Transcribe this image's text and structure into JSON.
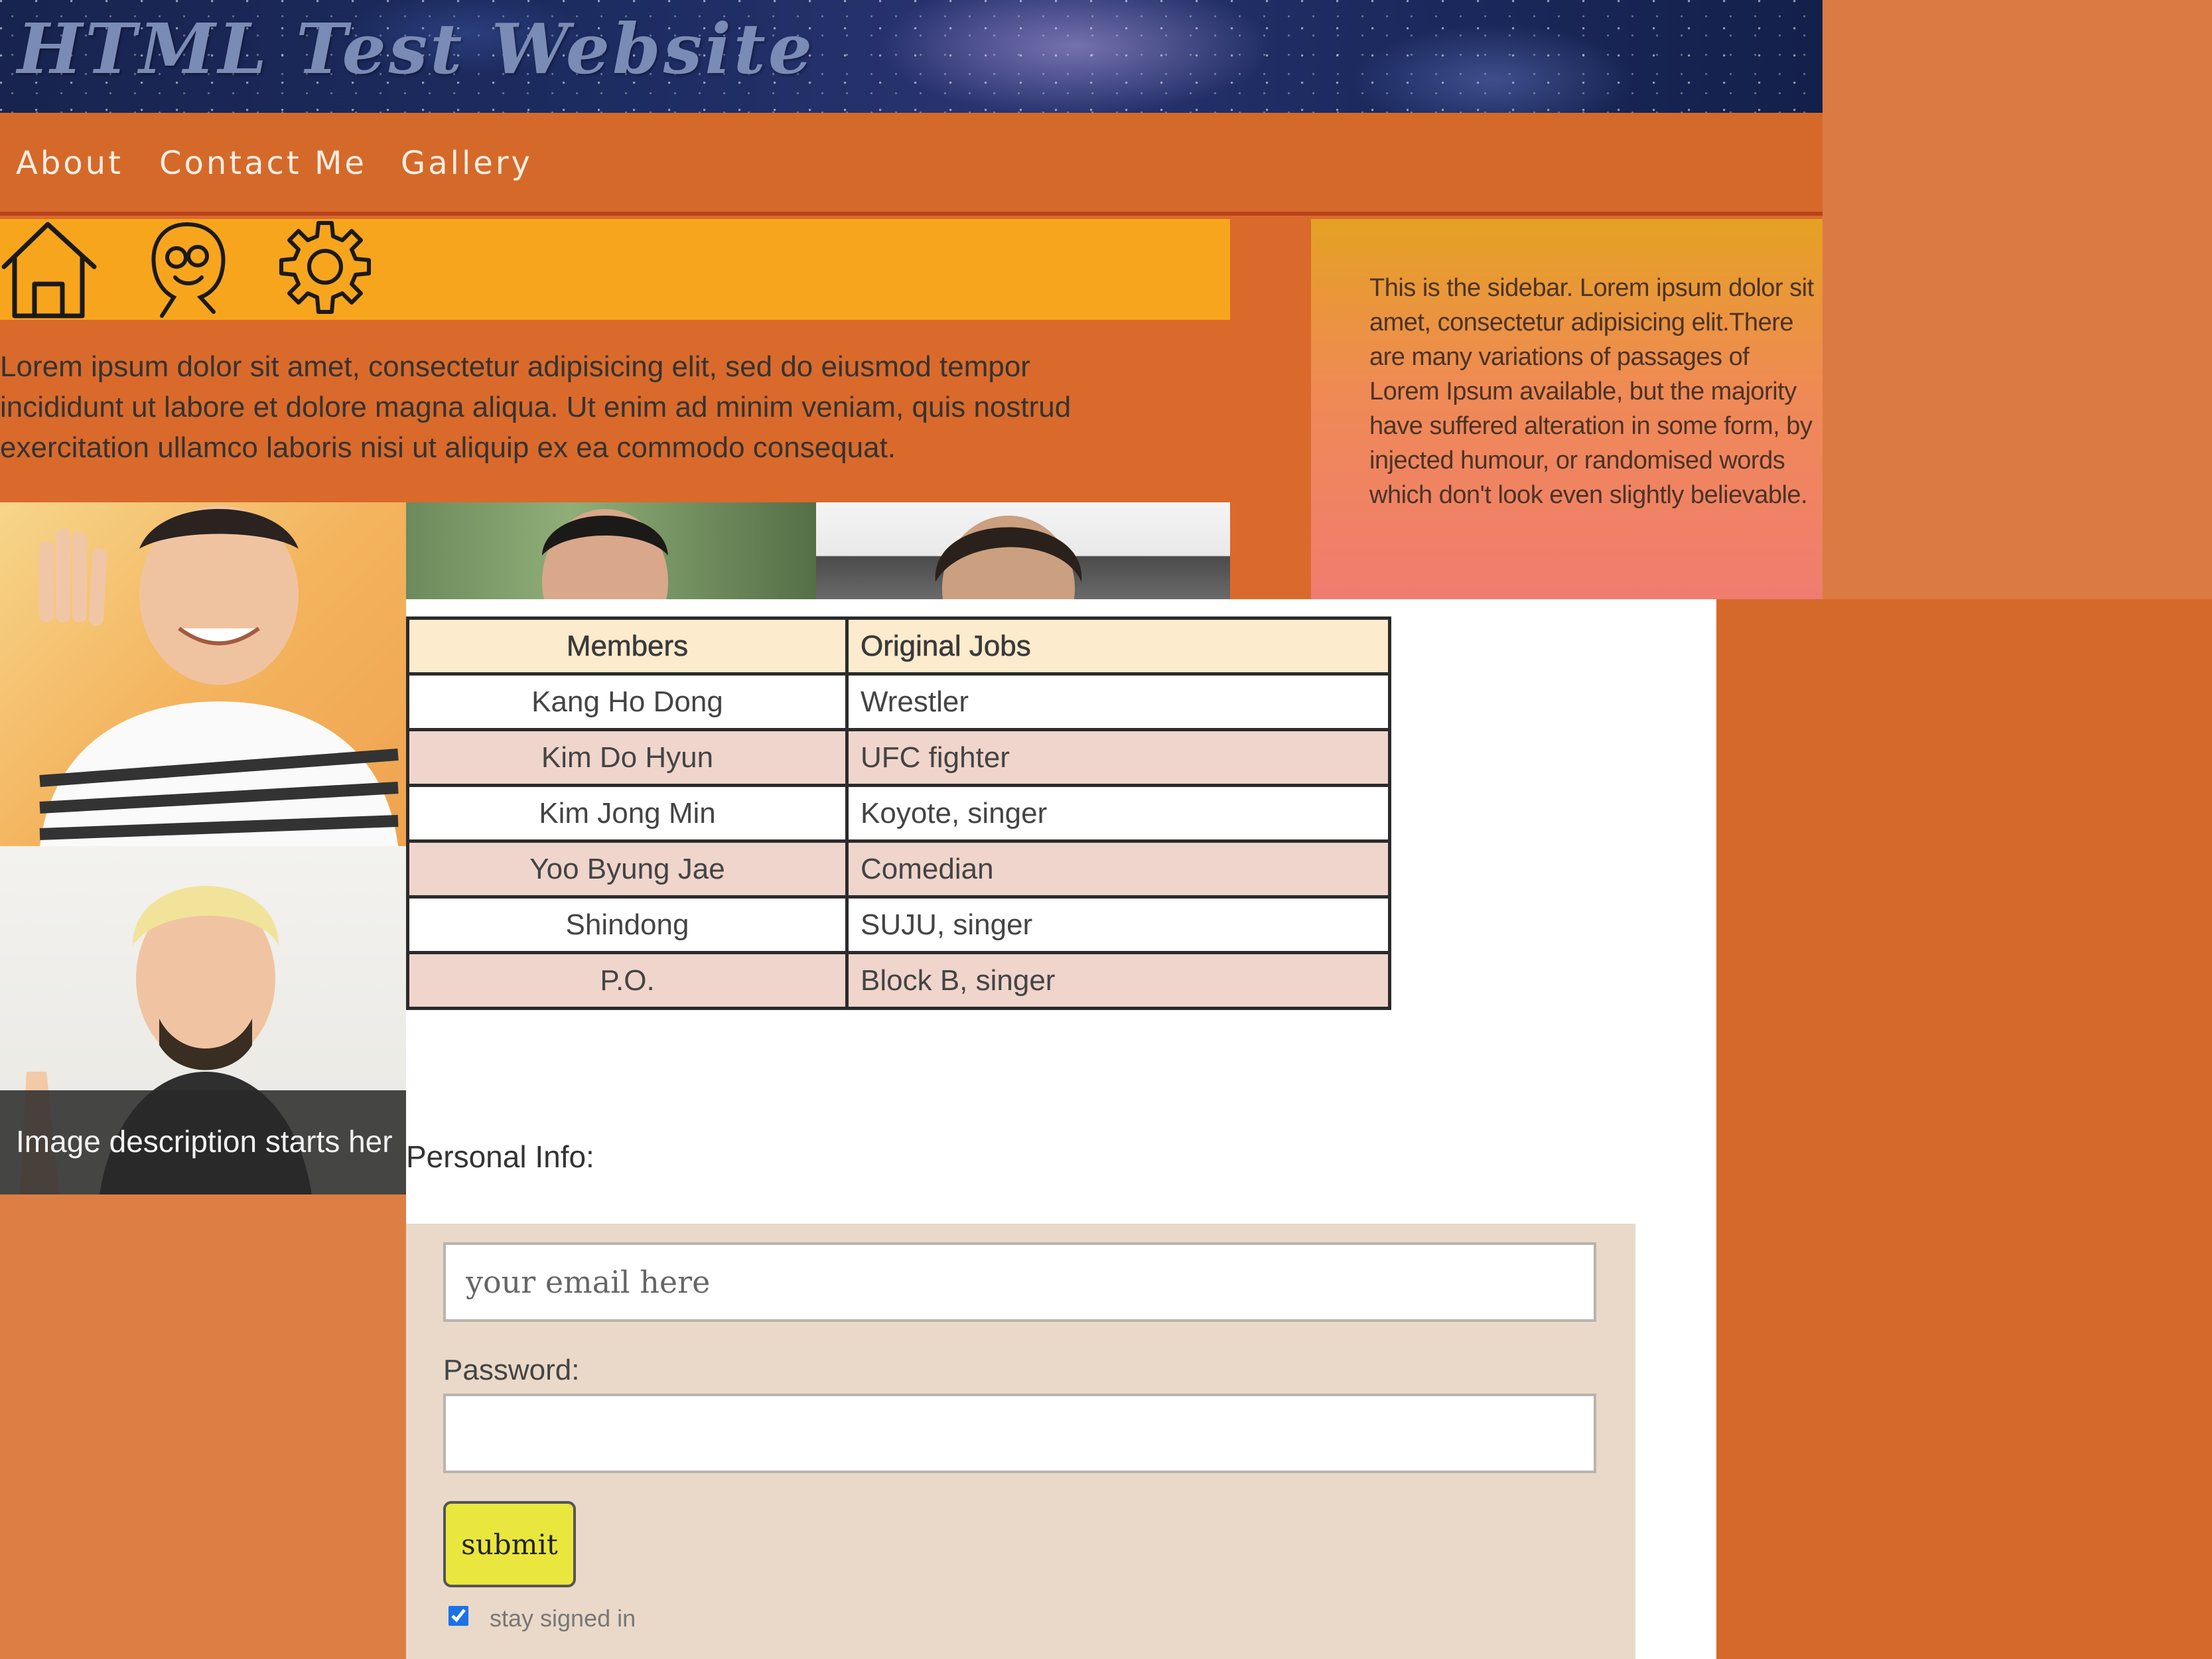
{
  "header": {
    "title": "HTML Test Website"
  },
  "nav": {
    "items": [
      {
        "label": "About"
      },
      {
        "label": "Contact Me"
      },
      {
        "label": "Gallery"
      }
    ]
  },
  "icon_bar": {
    "icons": [
      "home-icon",
      "face-icon",
      "gear-icon"
    ]
  },
  "main": {
    "intro_lines": [
      "Lorem ipsum dolor sit amet, consectetur adipisicing elit, sed do eiusmod tempor",
      "incididunt ut labore et dolore magna aliqua. Ut enim ad minim veniam, quis nostrud",
      "exercitation ullamco laboris nisi ut aliquip ex ea commodo consequat."
    ]
  },
  "sidebar": {
    "text": "This is the sidebar. Lorem ipsum dolor sit amet, consectetur adipisicing elit.There are many variations of passages of Lorem Ipsum available, but the majority have suffered alteration in some form, by injected humour, or randomised words which don't look even slightly believable."
  },
  "gallery": {
    "caption": "Image description starts her"
  },
  "table": {
    "headers": [
      "Members",
      "Original Jobs"
    ],
    "rows": [
      [
        "Kang Ho Dong",
        "Wrestler"
      ],
      [
        "Kim Do Hyun",
        "UFC fighter"
      ],
      [
        "Kim Jong Min",
        "Koyote, singer"
      ],
      [
        "Yoo Byung Jae",
        "Comedian"
      ],
      [
        "Shindong",
        "SUJU, singer"
      ],
      [
        "P.O.",
        "Block B, singer"
      ]
    ]
  },
  "form": {
    "section_label": "Personal Info:",
    "email_placeholder": "your email here",
    "email_value": "",
    "password_label": "Password:",
    "password_value": "",
    "submit_label": "submit",
    "remember_label": "stay signed in",
    "remember_checked": true
  },
  "colors": {
    "nav_bg": "#d5692a",
    "icon_bar_bg": "#f8a51e",
    "sidebar_top": "#e5a123",
    "sidebar_bottom": "#f07c70",
    "table_header_bg": "#fdebcd",
    "table_alt_row_bg": "#efd5cc",
    "form_bg": "#ead9c8",
    "submit_bg": "#e9e63e"
  }
}
